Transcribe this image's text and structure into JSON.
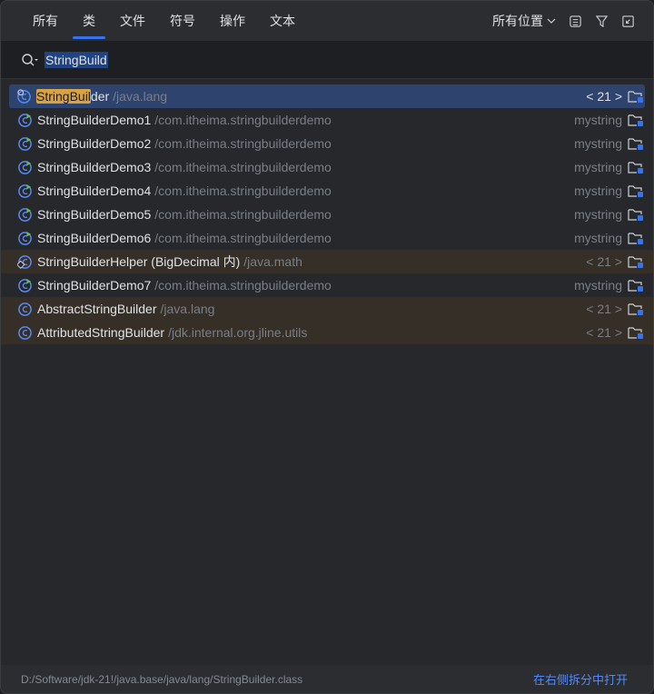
{
  "tabs": [
    {
      "label": "所有"
    },
    {
      "label": "类",
      "active": true
    },
    {
      "label": "文件"
    },
    {
      "label": "符号"
    },
    {
      "label": "操作"
    },
    {
      "label": "文本"
    }
  ],
  "scope": {
    "label": "所有位置"
  },
  "search": {
    "query": "StringBuild"
  },
  "results": [
    {
      "match": "StringBuil",
      "rest": "der",
      "pkg": "/java.lang",
      "right": "< 21 >",
      "kind": "class-lib",
      "selected": true
    },
    {
      "match": "",
      "rest": "StringBuilderDemo1",
      "pkg": "/com.itheima.stringbuilderdemo",
      "right": "mystring",
      "kind": "class-run"
    },
    {
      "match": "",
      "rest": "StringBuilderDemo2",
      "pkg": "/com.itheima.stringbuilderdemo",
      "right": "mystring",
      "kind": "class-run"
    },
    {
      "match": "",
      "rest": "StringBuilderDemo3",
      "pkg": "/com.itheima.stringbuilderdemo",
      "right": "mystring",
      "kind": "class-run"
    },
    {
      "match": "",
      "rest": "StringBuilderDemo4",
      "pkg": "/com.itheima.stringbuilderdemo",
      "right": "mystring",
      "kind": "class-run"
    },
    {
      "match": "",
      "rest": "StringBuilderDemo5",
      "pkg": "/com.itheima.stringbuilderdemo",
      "right": "mystring",
      "kind": "class-run"
    },
    {
      "match": "",
      "rest": "StringBuilderDemo6",
      "pkg": "/com.itheima.stringbuilderdemo",
      "right": "mystring",
      "kind": "class-run"
    },
    {
      "match": "",
      "rest": "StringBuilderHelper (BigDecimal 内)",
      "pkg": "/java.math",
      "right": "< 21 >",
      "kind": "class-inner",
      "lib": true
    },
    {
      "match": "",
      "rest": "StringBuilderDemo7",
      "pkg": "/com.itheima.stringbuilderdemo",
      "right": "mystring",
      "kind": "class-run"
    },
    {
      "match": "",
      "rest": "AbstractStringBuilder",
      "pkg": "/java.lang",
      "right": "< 21 >",
      "kind": "class",
      "lib": true
    },
    {
      "match": "",
      "rest": "AttributedStringBuilder",
      "pkg": "/jdk.internal.org.jline.utils",
      "right": "< 21 >",
      "kind": "class",
      "lib": true
    }
  ],
  "footer": {
    "path": "D:/Software/jdk-21!/java.base/java/lang/StringBuilder.class",
    "open_label": "在右侧拆分中打开"
  },
  "colors": {
    "accent": "#3574f0",
    "selection": "#2e436e",
    "match": "#d9a343",
    "link": "#548af7"
  }
}
